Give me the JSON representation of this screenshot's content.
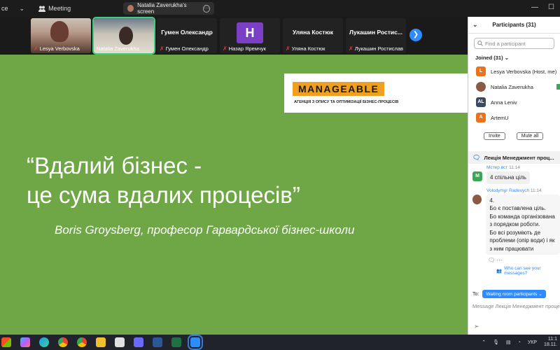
{
  "topbar": {
    "app_fragment": "ce",
    "meeting_label": "Meeting",
    "share_label": "Natalia Zaverukha's screen"
  },
  "strip": {
    "tiles": [
      {
        "name": "Lesya Verbovska"
      },
      {
        "name": "Natalia Zaverukha"
      },
      {
        "title": "Гумен Олександр",
        "name": "Гумен Олександр"
      },
      {
        "initial": "H",
        "name": "Назар Яремчук"
      },
      {
        "title": "Уляна Костюк",
        "name": "Уляна Костюк"
      },
      {
        "title": "Лукашин  Ростис...",
        "name": "Лукашин Ростислав"
      }
    ]
  },
  "slide": {
    "logo_word": "MANAGEABLE",
    "logo_sub": "АГЕНЦІЯ З ОПИСУ ТА ОПТИМІЗАЦІЇ БІЗНЕС-ПРОЦЕСІВ",
    "quote_line1": "“Вдалий бізнес -",
    "quote_line2": "це сума вдалих процесів”",
    "author": "Boris Groysberg, професор Гарвардської бізнес-школи",
    "background": "#6fa747"
  },
  "participants": {
    "title": "Participants (31)",
    "search_placeholder": "Find a participant",
    "joined_label": "Joined (31)",
    "people": [
      {
        "initial": "L",
        "name": "Lesya Verbovska (Host, me)",
        "color": "#e8731e"
      },
      {
        "initial": "",
        "name": "Natalia Zaverukha",
        "color": "#8a5a44"
      },
      {
        "initial": "AL",
        "name": "Anna Leniv",
        "color": "#3b4a63"
      },
      {
        "initial": "A",
        "name": "ArtemU",
        "color": "#e8731e"
      }
    ],
    "invite_label": "Invite",
    "mute_all_label": "Mute all"
  },
  "chat": {
    "title": "Лекція Менеджмент проц...",
    "messages": [
      {
        "sender": "Мстер вст",
        "time": "11:14",
        "avatar": "M",
        "avatar_color": "#3aa757",
        "text": "4 спільна ціль"
      },
      {
        "sender": "Volodymyr Radevych",
        "time": "11:14",
        "avatar": "",
        "avatar_color": "#8a5a44",
        "lines": [
          "4.",
          "Бо є поставлена ціль.",
          "Бо команда організована з порядком роботи.",
          "Бо всі розуміють де проблеми (опір води) і як з ним працювати"
        ]
      }
    ],
    "who_can_see": "Who can see your messages?",
    "to_label": "To:",
    "to_target": "Waiting room participants",
    "input_placeholder": "Message Лекція Менеджмент процесів"
  },
  "taskbar": {
    "lang": "УКР",
    "time": "11:1",
    "date": "18.11."
  }
}
